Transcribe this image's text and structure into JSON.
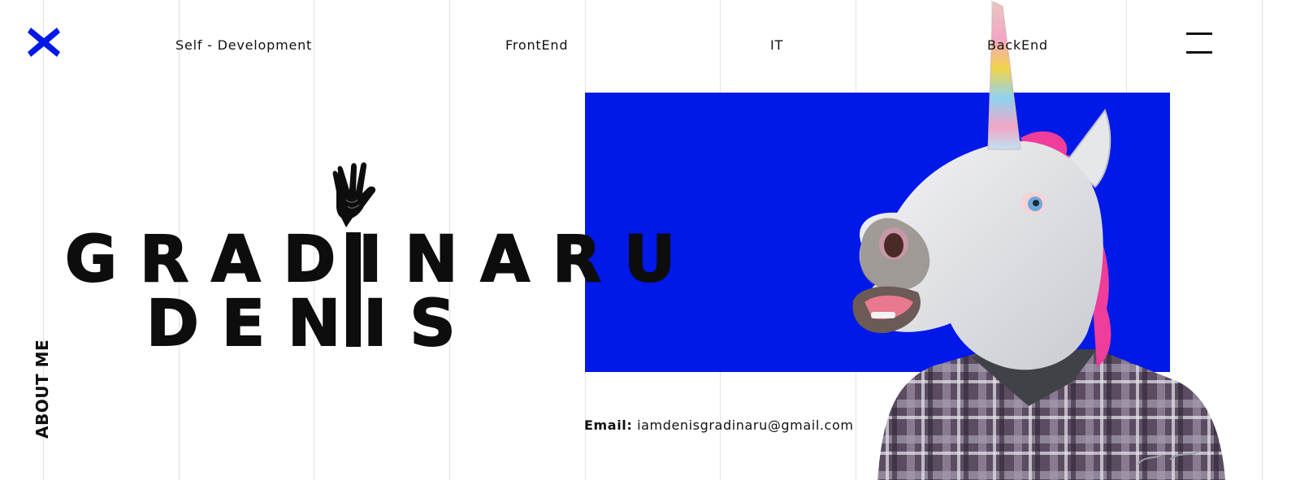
{
  "nav": {
    "items": [
      {
        "label": "Self - Development"
      },
      {
        "label": "FrontEnd"
      },
      {
        "label": "IT"
      },
      {
        "label": "BackEnd"
      }
    ]
  },
  "hero": {
    "first_line": "GRADINARU",
    "second_line": "DENIS"
  },
  "side": {
    "about_label": "ABOUT ME"
  },
  "contact": {
    "email_label": "Email:",
    "email_value": "iamdenisgradinaru@gmail.com"
  },
  "icons": {
    "logo": "x-logo-icon",
    "menu": "hamburger-menu-icon",
    "hand": "vulcan-salute-icon"
  },
  "colors": {
    "accent_blue": "#0018e8",
    "text": "#111111",
    "grid": "#e2e2e2"
  }
}
